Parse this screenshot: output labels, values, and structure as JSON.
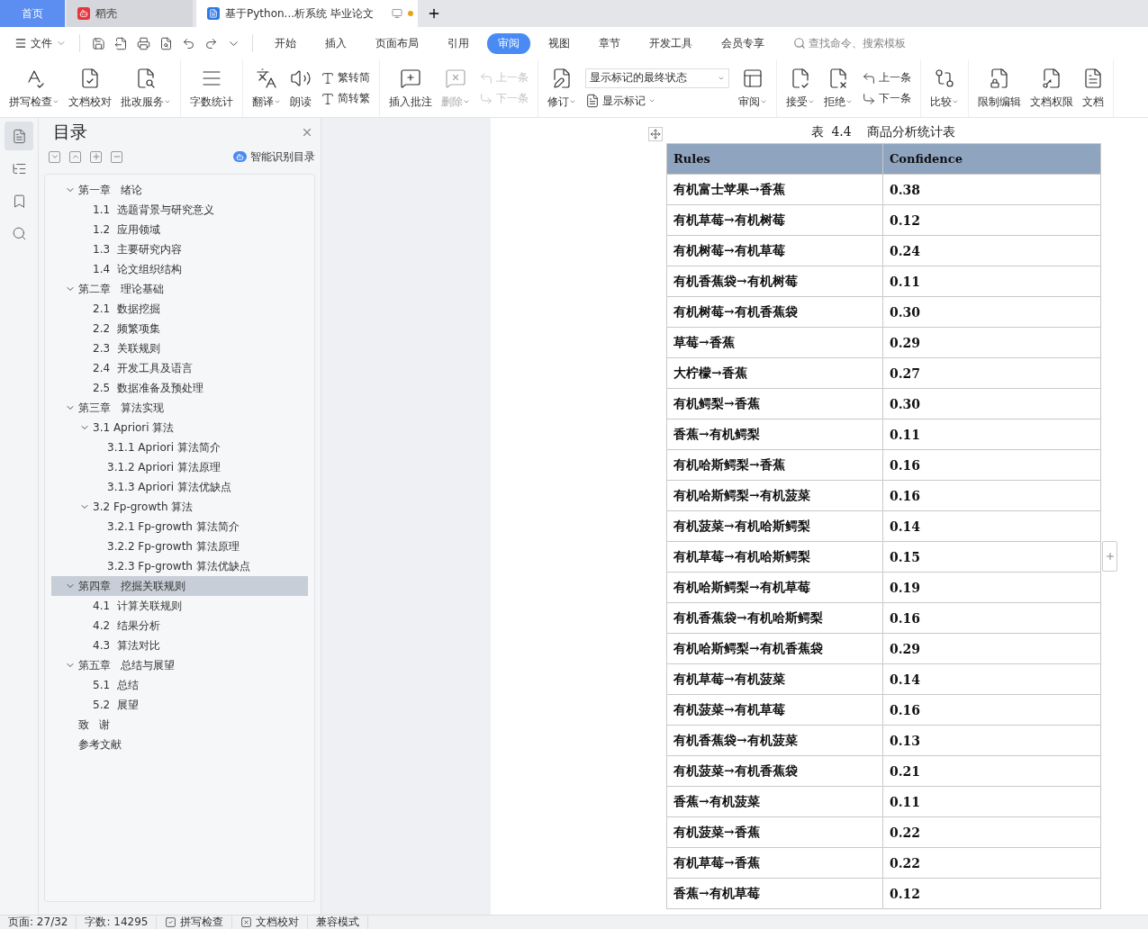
{
  "tabs": [
    {
      "kind": "home",
      "label": "首页",
      "selected": false
    },
    {
      "kind": "app",
      "label": "稻壳",
      "selected": false
    },
    {
      "kind": "doc",
      "label": "基于Python...析系统 毕业论文",
      "selected": true,
      "modified": true
    }
  ],
  "menu": {
    "file": "文件",
    "tabs": [
      {
        "label": "开始",
        "selected": false
      },
      {
        "label": "插入",
        "selected": false
      },
      {
        "label": "页面布局",
        "selected": false
      },
      {
        "label": "引用",
        "selected": false
      },
      {
        "label": "审阅",
        "selected": true
      },
      {
        "label": "视图",
        "selected": false
      },
      {
        "label": "章节",
        "selected": false
      },
      {
        "label": "开发工具",
        "selected": false
      },
      {
        "label": "会员专享",
        "selected": false
      }
    ],
    "search": {
      "placeholder": "查找命令、搜索模板"
    }
  },
  "ribbon": [
    {
      "items": [
        {
          "kind": "large",
          "label": "拼写检查",
          "dropdown": true,
          "disabled": false
        },
        {
          "kind": "large",
          "label": "文档校对",
          "dropdown": false,
          "disabled": false
        },
        {
          "kind": "large",
          "label": "批改服务",
          "dropdown": true,
          "disabled": false
        }
      ]
    },
    {
      "items": [
        {
          "kind": "large",
          "label": "字数统计",
          "dropdown": false,
          "disabled": false
        }
      ]
    },
    {
      "items": [
        {
          "kind": "large",
          "label": "翻译",
          "dropdown": true,
          "disabled": false
        },
        {
          "kind": "large",
          "label": "朗读",
          "dropdown": false,
          "disabled": false
        },
        {
          "kind": "stack",
          "items": [
            {
              "kind": "small",
              "label": "繁转简",
              "dropdown": false,
              "disabled": false
            },
            {
              "kind": "small",
              "label": "简转繁",
              "dropdown": false,
              "disabled": false
            }
          ]
        }
      ]
    },
    {
      "items": [
        {
          "kind": "large",
          "label": "插入批注",
          "dropdown": false,
          "disabled": false
        },
        {
          "kind": "large",
          "label": "删除",
          "dropdown": true,
          "disabled": true
        },
        {
          "kind": "stack",
          "items": [
            {
              "kind": "small",
              "label": "上一条",
              "dropdown": false,
              "disabled": true
            },
            {
              "kind": "small",
              "label": "下一条",
              "dropdown": false,
              "disabled": true
            }
          ]
        }
      ]
    },
    {
      "items": [
        {
          "kind": "large",
          "label": "修订",
          "dropdown": true,
          "disabled": false
        },
        {
          "kind": "stack",
          "items": [
            {
              "kind": "select",
              "label": "显示标记的最终状态",
              "dropdown": true
            },
            {
              "kind": "small",
              "label": "显示标记",
              "dropdown": true,
              "disabled": false
            }
          ]
        },
        {
          "kind": "large",
          "label": "审阅",
          "dropdown": true,
          "disabled": false
        }
      ]
    },
    {
      "items": [
        {
          "kind": "large",
          "label": "接受",
          "dropdown": true,
          "disabled": false
        },
        {
          "kind": "large",
          "label": "拒绝",
          "dropdown": true,
          "disabled": false
        },
        {
          "kind": "stack",
          "items": [
            {
              "kind": "small",
              "label": "上一条",
              "dropdown": false,
              "disabled": false
            },
            {
              "kind": "small",
              "label": "下一条",
              "dropdown": false,
              "disabled": false
            }
          ]
        }
      ]
    },
    {
      "items": [
        {
          "kind": "large",
          "label": "比较",
          "dropdown": true,
          "disabled": false
        }
      ]
    },
    {
      "items": [
        {
          "kind": "large",
          "label": "限制编辑",
          "dropdown": false,
          "disabled": false
        },
        {
          "kind": "large",
          "label": "文档权限",
          "dropdown": false,
          "disabled": false
        },
        {
          "kind": "large",
          "label": "文档",
          "dropdown": false,
          "disabled": false
        }
      ]
    }
  ],
  "rail": [
    {
      "selected": true
    },
    {
      "selected": false
    },
    {
      "selected": false
    },
    {
      "selected": false
    }
  ],
  "toc": {
    "title": "目录",
    "smart": "智能识别目录",
    "items": [
      {
        "label": "第一章   绪论",
        "selected": false,
        "expanded": true,
        "children": [
          {
            "label": "1.1  选题背景与研究意义",
            "selected": false
          },
          {
            "label": "1.2  应用领域",
            "selected": false
          },
          {
            "label": "1.3  主要研究内容",
            "selected": false
          },
          {
            "label": "1.4  论文组织结构",
            "selected": false
          }
        ]
      },
      {
        "label": "第二章   理论基础",
        "selected": false,
        "expanded": true,
        "children": [
          {
            "label": "2.1  数据挖掘",
            "selected": false
          },
          {
            "label": "2.2  频繁项集",
            "selected": false
          },
          {
            "label": "2.3  关联规则",
            "selected": false
          },
          {
            "label": "2.4  开发工具及语言",
            "selected": false
          },
          {
            "label": "2.5  数据准备及预处理",
            "selected": false
          }
        ]
      },
      {
        "label": "第三章   算法实现",
        "selected": false,
        "expanded": true,
        "children": [
          {
            "label": "3.1 Apriori 算法",
            "selected": false,
            "expanded": true,
            "children": [
              {
                "label": "3.1.1 Apriori 算法简介",
                "selected": false
              },
              {
                "label": "3.1.2 Apriori 算法原理",
                "selected": false
              },
              {
                "label": "3.1.3 Apriori 算法优缺点",
                "selected": false
              }
            ]
          },
          {
            "label": "3.2 Fp-growth 算法",
            "selected": false,
            "expanded": true,
            "children": [
              {
                "label": "3.2.1 Fp-growth 算法简介",
                "selected": false
              },
              {
                "label": "3.2.2 Fp-growth 算法原理",
                "selected": false
              },
              {
                "label": "3.2.3 Fp-growth 算法优缺点",
                "selected": false
              }
            ]
          }
        ]
      },
      {
        "label": "第四章   挖掘关联规则",
        "selected": true,
        "expanded": true,
        "children": [
          {
            "label": "4.1  计算关联规则",
            "selected": false
          },
          {
            "label": "4.2  结果分析",
            "selected": false
          },
          {
            "label": "4.3  算法对比",
            "selected": false
          }
        ]
      },
      {
        "label": "第五章   总结与展望",
        "selected": false,
        "expanded": true,
        "children": [
          {
            "label": "5.1  总结",
            "selected": false
          },
          {
            "label": "5.2  展望",
            "selected": false
          }
        ]
      },
      {
        "label": "致   谢",
        "selected": false
      },
      {
        "label": "参考文献",
        "selected": false
      }
    ]
  },
  "document": {
    "caption": "表  4.4    商品分析统计表",
    "table": {
      "columns": [
        "Rules",
        "Confidence"
      ],
      "rows": [
        [
          "有机富士苹果→香蕉",
          "0.38"
        ],
        [
          "有机草莓→有机树莓",
          "0.12"
        ],
        [
          "有机树莓→有机草莓",
          "0.24"
        ],
        [
          "有机香蕉袋→有机树莓",
          "0.11"
        ],
        [
          "有机树莓→有机香蕉袋",
          "0.30"
        ],
        [
          "草莓→香蕉",
          "0.29"
        ],
        [
          "大柠檬→香蕉",
          "0.27"
        ],
        [
          "有机鳄梨→香蕉",
          "0.30"
        ],
        [
          "香蕉→有机鳄梨",
          "0.11"
        ],
        [
          "有机哈斯鳄梨→香蕉",
          "0.16"
        ],
        [
          "有机哈斯鳄梨→有机菠菜",
          "0.16"
        ],
        [
          "有机菠菜→有机哈斯鳄梨",
          "0.14"
        ],
        [
          "有机草莓→有机哈斯鳄梨",
          "0.15"
        ],
        [
          "有机哈斯鳄梨→有机草莓",
          "0.19"
        ],
        [
          "有机香蕉袋→有机哈斯鳄梨",
          "0.16"
        ],
        [
          "有机哈斯鳄梨→有机香蕉袋",
          "0.29"
        ],
        [
          "有机草莓→有机菠菜",
          "0.14"
        ],
        [
          "有机菠菜→有机草莓",
          "0.16"
        ],
        [
          "有机香蕉袋→有机菠菜",
          "0.13"
        ],
        [
          "有机菠菜→有机香蕉袋",
          "0.21"
        ],
        [
          "香蕉→有机菠菜",
          "0.11"
        ],
        [
          "有机菠菜→香蕉",
          "0.22"
        ],
        [
          "有机草莓→香蕉",
          "0.22"
        ],
        [
          "香蕉→有机草莓",
          "0.12"
        ]
      ]
    }
  },
  "status": [
    {
      "kind": "text",
      "label": "页面: 27/32"
    },
    {
      "kind": "text",
      "label": "字数: 14295"
    },
    {
      "kind": "check",
      "label": "拼写检查",
      "checked": true
    },
    {
      "kind": "proof",
      "label": "文档校对"
    },
    {
      "kind": "text",
      "label": "兼容模式"
    }
  ]
}
